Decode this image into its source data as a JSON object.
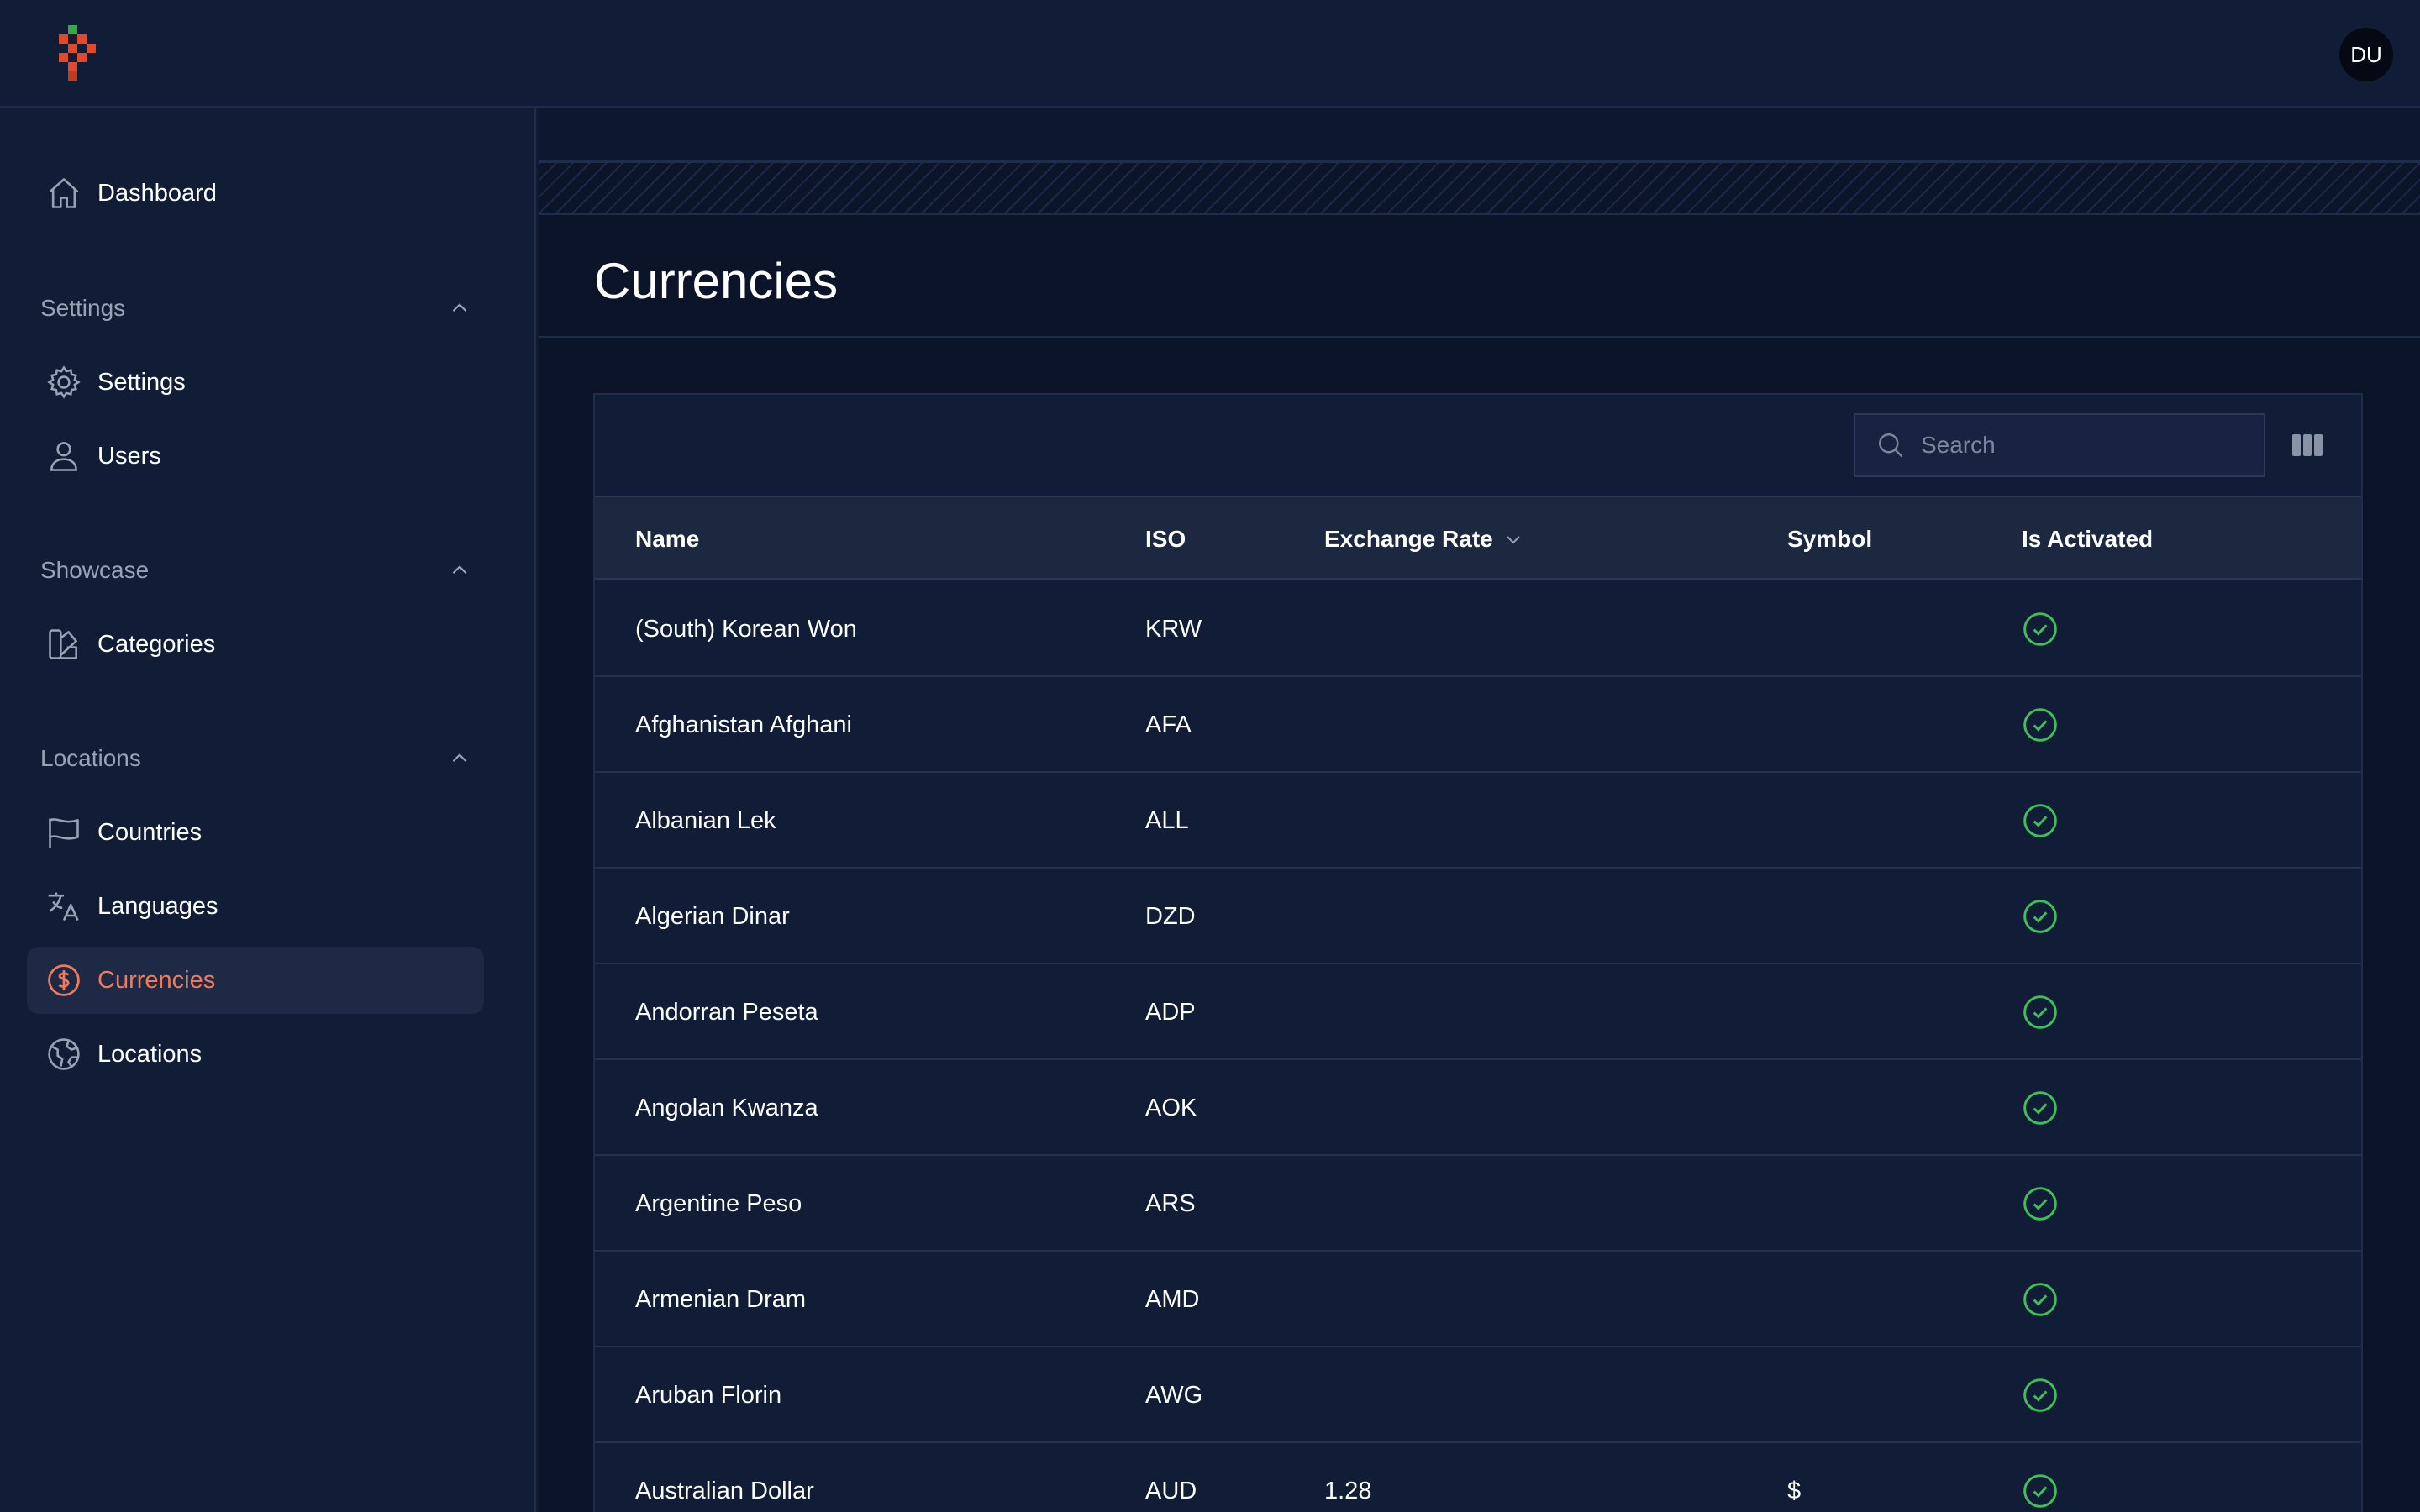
{
  "header": {
    "avatar_initials": "DU"
  },
  "sidebar": {
    "dashboard": {
      "label": "Dashboard",
      "icon": "home-icon"
    },
    "groups": [
      {
        "label": "Settings",
        "items": [
          {
            "label": "Settings",
            "icon": "gear-icon"
          },
          {
            "label": "Users",
            "icon": "user-icon"
          }
        ]
      },
      {
        "label": "Showcase",
        "items": [
          {
            "label": "Categories",
            "icon": "swatch-icon"
          }
        ]
      },
      {
        "label": "Locations",
        "items": [
          {
            "label": "Countries",
            "icon": "flag-icon"
          },
          {
            "label": "Languages",
            "icon": "translate-icon"
          },
          {
            "label": "Currencies",
            "icon": "currency-dollar-icon",
            "active": true
          },
          {
            "label": "Locations",
            "icon": "globe-icon"
          }
        ]
      }
    ]
  },
  "page": {
    "title": "Currencies"
  },
  "table": {
    "search_placeholder": "Search",
    "columns": [
      "Name",
      "ISO",
      "Exchange Rate",
      "Symbol",
      "Is Activated"
    ],
    "rows": [
      {
        "name": "(South) Korean Won",
        "iso": "KRW",
        "rate": "",
        "symbol": "",
        "activated": true
      },
      {
        "name": "Afghanistan Afghani",
        "iso": "AFA",
        "rate": "",
        "symbol": "",
        "activated": true
      },
      {
        "name": "Albanian Lek",
        "iso": "ALL",
        "rate": "",
        "symbol": "",
        "activated": true
      },
      {
        "name": "Algerian Dinar",
        "iso": "DZD",
        "rate": "",
        "symbol": "",
        "activated": true
      },
      {
        "name": "Andorran Peseta",
        "iso": "ADP",
        "rate": "",
        "symbol": "",
        "activated": true
      },
      {
        "name": "Angolan Kwanza",
        "iso": "AOK",
        "rate": "",
        "symbol": "",
        "activated": true
      },
      {
        "name": "Argentine Peso",
        "iso": "ARS",
        "rate": "",
        "symbol": "",
        "activated": true
      },
      {
        "name": "Armenian Dram",
        "iso": "AMD",
        "rate": "",
        "symbol": "",
        "activated": true
      },
      {
        "name": "Aruban Florin",
        "iso": "AWG",
        "rate": "",
        "symbol": "",
        "activated": true
      },
      {
        "name": "Australian Dollar",
        "iso": "AUD",
        "rate": "1.28",
        "symbol": "$",
        "activated": true
      }
    ]
  },
  "colors": {
    "accent": "#f07a5e",
    "check": "#3fbf5a",
    "background": "#0f1b33"
  }
}
